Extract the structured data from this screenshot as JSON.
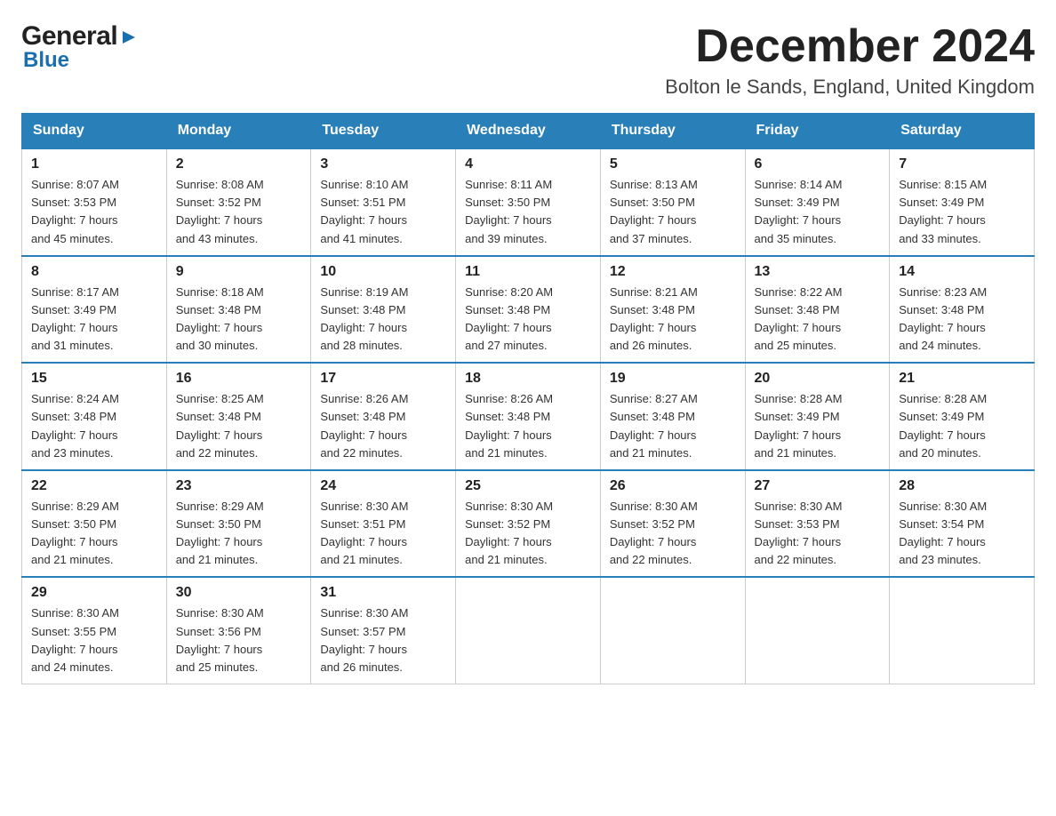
{
  "header": {
    "logo_general": "General",
    "logo_blue": "Blue",
    "month": "December 2024",
    "location": "Bolton le Sands, England, United Kingdom"
  },
  "weekdays": [
    "Sunday",
    "Monday",
    "Tuesday",
    "Wednesday",
    "Thursday",
    "Friday",
    "Saturday"
  ],
  "weeks": [
    [
      {
        "day": "1",
        "sunrise": "8:07 AM",
        "sunset": "3:53 PM",
        "daylight": "7 hours and 45 minutes."
      },
      {
        "day": "2",
        "sunrise": "8:08 AM",
        "sunset": "3:52 PM",
        "daylight": "7 hours and 43 minutes."
      },
      {
        "day": "3",
        "sunrise": "8:10 AM",
        "sunset": "3:51 PM",
        "daylight": "7 hours and 41 minutes."
      },
      {
        "day": "4",
        "sunrise": "8:11 AM",
        "sunset": "3:50 PM",
        "daylight": "7 hours and 39 minutes."
      },
      {
        "day": "5",
        "sunrise": "8:13 AM",
        "sunset": "3:50 PM",
        "daylight": "7 hours and 37 minutes."
      },
      {
        "day": "6",
        "sunrise": "8:14 AM",
        "sunset": "3:49 PM",
        "daylight": "7 hours and 35 minutes."
      },
      {
        "day": "7",
        "sunrise": "8:15 AM",
        "sunset": "3:49 PM",
        "daylight": "7 hours and 33 minutes."
      }
    ],
    [
      {
        "day": "8",
        "sunrise": "8:17 AM",
        "sunset": "3:49 PM",
        "daylight": "7 hours and 31 minutes."
      },
      {
        "day": "9",
        "sunrise": "8:18 AM",
        "sunset": "3:48 PM",
        "daylight": "7 hours and 30 minutes."
      },
      {
        "day": "10",
        "sunrise": "8:19 AM",
        "sunset": "3:48 PM",
        "daylight": "7 hours and 28 minutes."
      },
      {
        "day": "11",
        "sunrise": "8:20 AM",
        "sunset": "3:48 PM",
        "daylight": "7 hours and 27 minutes."
      },
      {
        "day": "12",
        "sunrise": "8:21 AM",
        "sunset": "3:48 PM",
        "daylight": "7 hours and 26 minutes."
      },
      {
        "day": "13",
        "sunrise": "8:22 AM",
        "sunset": "3:48 PM",
        "daylight": "7 hours and 25 minutes."
      },
      {
        "day": "14",
        "sunrise": "8:23 AM",
        "sunset": "3:48 PM",
        "daylight": "7 hours and 24 minutes."
      }
    ],
    [
      {
        "day": "15",
        "sunrise": "8:24 AM",
        "sunset": "3:48 PM",
        "daylight": "7 hours and 23 minutes."
      },
      {
        "day": "16",
        "sunrise": "8:25 AM",
        "sunset": "3:48 PM",
        "daylight": "7 hours and 22 minutes."
      },
      {
        "day": "17",
        "sunrise": "8:26 AM",
        "sunset": "3:48 PM",
        "daylight": "7 hours and 22 minutes."
      },
      {
        "day": "18",
        "sunrise": "8:26 AM",
        "sunset": "3:48 PM",
        "daylight": "7 hours and 21 minutes."
      },
      {
        "day": "19",
        "sunrise": "8:27 AM",
        "sunset": "3:48 PM",
        "daylight": "7 hours and 21 minutes."
      },
      {
        "day": "20",
        "sunrise": "8:28 AM",
        "sunset": "3:49 PM",
        "daylight": "7 hours and 21 minutes."
      },
      {
        "day": "21",
        "sunrise": "8:28 AM",
        "sunset": "3:49 PM",
        "daylight": "7 hours and 20 minutes."
      }
    ],
    [
      {
        "day": "22",
        "sunrise": "8:29 AM",
        "sunset": "3:50 PM",
        "daylight": "7 hours and 21 minutes."
      },
      {
        "day": "23",
        "sunrise": "8:29 AM",
        "sunset": "3:50 PM",
        "daylight": "7 hours and 21 minutes."
      },
      {
        "day": "24",
        "sunrise": "8:30 AM",
        "sunset": "3:51 PM",
        "daylight": "7 hours and 21 minutes."
      },
      {
        "day": "25",
        "sunrise": "8:30 AM",
        "sunset": "3:52 PM",
        "daylight": "7 hours and 21 minutes."
      },
      {
        "day": "26",
        "sunrise": "8:30 AM",
        "sunset": "3:52 PM",
        "daylight": "7 hours and 22 minutes."
      },
      {
        "day": "27",
        "sunrise": "8:30 AM",
        "sunset": "3:53 PM",
        "daylight": "7 hours and 22 minutes."
      },
      {
        "day": "28",
        "sunrise": "8:30 AM",
        "sunset": "3:54 PM",
        "daylight": "7 hours and 23 minutes."
      }
    ],
    [
      {
        "day": "29",
        "sunrise": "8:30 AM",
        "sunset": "3:55 PM",
        "daylight": "7 hours and 24 minutes."
      },
      {
        "day": "30",
        "sunrise": "8:30 AM",
        "sunset": "3:56 PM",
        "daylight": "7 hours and 25 minutes."
      },
      {
        "day": "31",
        "sunrise": "8:30 AM",
        "sunset": "3:57 PM",
        "daylight": "7 hours and 26 minutes."
      },
      null,
      null,
      null,
      null
    ]
  ],
  "labels": {
    "sunrise": "Sunrise:",
    "sunset": "Sunset:",
    "daylight": "Daylight:"
  }
}
